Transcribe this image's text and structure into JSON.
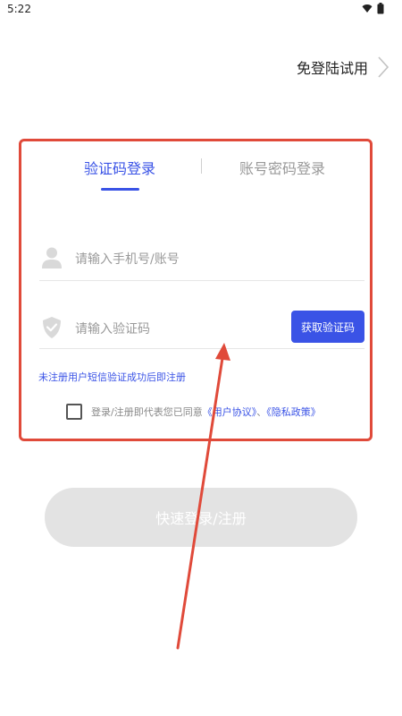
{
  "status_bar": {
    "time": "5:22",
    "icons": [
      "wifi-icon",
      "battery-icon"
    ]
  },
  "header": {
    "skip_login_label": "免登陆试用",
    "skip_icon": "chevron-right-icon"
  },
  "tabs": [
    {
      "label": "验证码登录",
      "active": true
    },
    {
      "label": "账号密码登录",
      "active": false
    }
  ],
  "form": {
    "phone": {
      "placeholder": "请输入手机号/账号",
      "value": "",
      "icon": "user-icon"
    },
    "code": {
      "placeholder": "请输入验证码",
      "value": "",
      "icon": "shield-icon"
    },
    "get_code_label": "获取验证码",
    "register_note": "未注册用户短信验证成功后即注册",
    "agreement": {
      "checked": false,
      "prefix": "登录/注册即代表您已同意",
      "user_agreement": "《用户协议》",
      "separator": "、",
      "privacy_policy": "《隐私政策》"
    }
  },
  "login_button_label": "快速登录/注册",
  "colors": {
    "accent": "#3a53e6",
    "annotation": "#e04a3a",
    "disabled_button": "#e3e3e3"
  }
}
